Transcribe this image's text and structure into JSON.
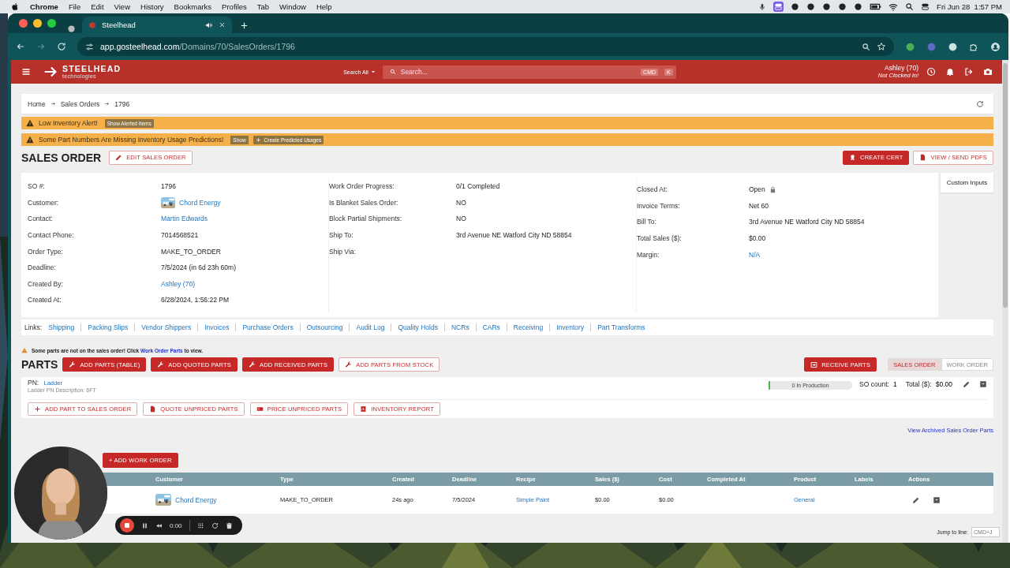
{
  "menubar": {
    "app": "Chrome",
    "menus": [
      "File",
      "Edit",
      "View",
      "History",
      "Bookmarks",
      "Profiles",
      "Tab",
      "Window",
      "Help"
    ],
    "clock": "Fri Jun 28  1:57 PM"
  },
  "browser": {
    "tab_title": "Steelhead",
    "url_host": "app.gosteelhead.com",
    "url_path": "/Domains/70/SalesOrders/1796"
  },
  "header": {
    "logo": "STEELHEAD",
    "logo_sub": "technologies",
    "search_scope": "Search All",
    "search_placeholder": "Search...",
    "shortcut_keys": [
      "CMD",
      "K"
    ],
    "user": "Ashley (70)",
    "user_status": "Not Clocked In!"
  },
  "breadcrumbs": [
    "Home",
    "Sales Orders",
    "1796"
  ],
  "alerts": [
    {
      "text": "Low Inventory Alert!",
      "actions": [
        {
          "label": "Show Alerted Items",
          "kind": "plain"
        }
      ]
    },
    {
      "text": "Some Part Numbers Are Missing Inventory Usage Predictions!",
      "actions": [
        {
          "label": "Show",
          "kind": "plain"
        },
        {
          "label": "Create Predicted Usages",
          "kind": "add"
        }
      ]
    }
  ],
  "title": "SALES ORDER",
  "edit_button": "EDIT SALES ORDER",
  "title_actions": [
    {
      "label": "CREATE CERT",
      "kind": "filled"
    },
    {
      "label": "VIEW / SEND PDFS",
      "kind": "outline"
    }
  ],
  "details": [
    [
      {
        "label": "SO #:",
        "value": "1796",
        "kind": "text"
      },
      {
        "label": "Customer:",
        "value": "Chord Energy",
        "kind": "customer"
      },
      {
        "label": "Contact:",
        "value": "Martin Edwards",
        "kind": "link"
      },
      {
        "label": "Contact Phone:",
        "value": "7014568521",
        "kind": "text"
      },
      {
        "label": "Order Type:",
        "value": "MAKE_TO_ORDER",
        "kind": "text"
      },
      {
        "label": "Deadline:",
        "value": "7/5/2024 (in 6d 23h 60m)",
        "kind": "text"
      },
      {
        "label": "Created By:",
        "value": "Ashley (70)",
        "kind": "link"
      },
      {
        "label": "Created At:",
        "value": "6/28/2024, 1:56:22 PM",
        "kind": "text"
      }
    ],
    [
      {
        "label": "Work Order Progress:",
        "value": "0/1 Completed",
        "kind": "text"
      },
      {
        "label": "Is Blanket Sales Order:",
        "value": "NO",
        "kind": "text"
      },
      {
        "label": "Block Partial Shipments:",
        "value": "NO",
        "kind": "text"
      },
      {
        "label": "Ship To:",
        "value": "3rd Avenue NE Watford City ND 58854",
        "kind": "text"
      },
      {
        "label": "Ship Via:"
      }
    ],
    [
      {
        "label": "Closed At:",
        "value": "Open",
        "kind": "locked"
      },
      {
        "label": "Invoice Terms:",
        "value": "Net 60",
        "kind": "text"
      },
      {
        "label": "Bill To:",
        "value": "3rd Avenue NE Watford City ND 58854",
        "kind": "text"
      },
      {
        "label": "Total Sales ($):",
        "value": "$0.00",
        "kind": "text"
      },
      {
        "label": "Margin:",
        "value": "N/A",
        "kind": "link"
      }
    ]
  ],
  "custom_inputs_tab": "Custom Inputs",
  "links": {
    "label": "Links:",
    "items": [
      "Shipping",
      "Packing Slips",
      "Vendor Shippers",
      "Invoices",
      "Purchase Orders",
      "Outsourcing",
      "Audit Log",
      "Quality Holds",
      "NCRs",
      "CARs",
      "Receiving",
      "Inventory",
      "Part Transforms"
    ]
  },
  "notice": {
    "before": "Some parts are not on the sales order! Click",
    "link": "Work Order Parts",
    "after": "to view."
  },
  "parts": {
    "title": "PARTS",
    "add_buttons": [
      {
        "label": "ADD PARTS (TABLE)",
        "kind": "filled"
      },
      {
        "label": "ADD QUOTED PARTS",
        "kind": "filled"
      },
      {
        "label": "ADD RECEIVED PARTS",
        "kind": "filled"
      },
      {
        "label": "ADD PARTS FROM STOCK",
        "kind": "outline"
      }
    ],
    "receive_button": "RECEIVE PARTS",
    "views": [
      {
        "label": "SALES ORDER",
        "selected": true
      },
      {
        "label": "WORK ORDER",
        "selected": false
      }
    ],
    "items": [
      {
        "pn_label": "PN:",
        "pn": "Ladder",
        "description": "Ladder PN Description: 6FT",
        "production": "0 In Production",
        "level": 0,
        "so_count_label": "SO count:",
        "so_count": "1",
        "total_label": "Total ($):",
        "total": "$0.00"
      }
    ],
    "actions": [
      "ADD PART TO SALES ORDER",
      "QUOTE UNPRICED PARTS",
      "PRICE UNPRICED PARTS",
      "INVENTORY REPORT"
    ],
    "archived_link": "View Archived Sales Order Parts"
  },
  "work_orders": {
    "add_button": "+ ADD WORK ORDER",
    "columns": [
      "Customer",
      "Type",
      "Created",
      "Deadline",
      "Recipe",
      "Sales ($)",
      "Cost",
      "Completed At",
      "Product",
      "Labels",
      "Actions"
    ],
    "rows": [
      {
        "customer": "Chord Energy",
        "type": "MAKE_TO_ORDER",
        "created": "24s ago",
        "deadline": "7/5/2024",
        "recipe": "Simple Paint",
        "sales": "$0.00",
        "cost": "$0.00",
        "product": "General"
      }
    ]
  },
  "jump": {
    "label": "Jump to line:",
    "placeholder": "CMD+J"
  },
  "recorder": {
    "time": "0:00"
  }
}
